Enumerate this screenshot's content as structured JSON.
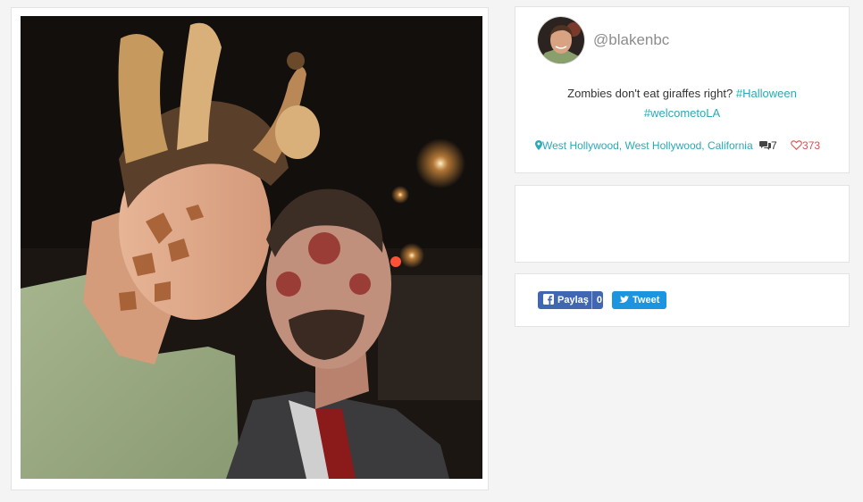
{
  "post": {
    "photo_alt": "",
    "username": "@blakenbc",
    "caption_text": "Zombies don't eat giraffes right?",
    "hashtags": [
      "#Halloween",
      "#welcometoLA"
    ],
    "location": "West Hollywood, West Hollywood, California",
    "comments_count": "7",
    "likes_count": "373"
  },
  "share": {
    "facebook_label": "Paylaş",
    "facebook_count": "0",
    "twitter_label": "Tweet"
  },
  "colors": {
    "background": "#f4f4f4",
    "hashtag_teal": "#2aa9b8",
    "heart_red": "#d9534f",
    "facebook_blue": "#4267b2",
    "twitter_blue": "#1b95e0"
  },
  "icons": {
    "location": "map-marker-icon",
    "comments": "comments-icon",
    "likes": "heart-outline-icon",
    "facebook": "facebook-icon",
    "twitter": "twitter-bird-icon"
  }
}
